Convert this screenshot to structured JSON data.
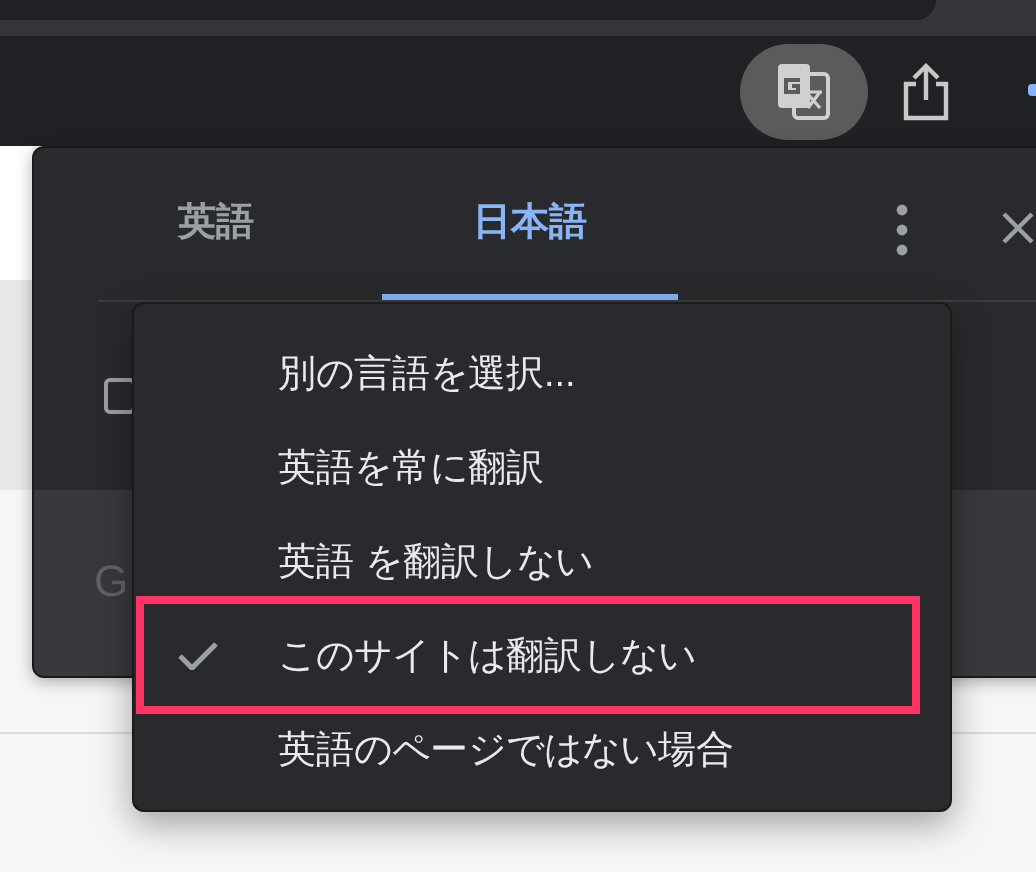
{
  "tabs": [
    {
      "label": "英語",
      "selected": false
    },
    {
      "label": "日本語",
      "selected": true
    }
  ],
  "checkbox": {
    "checked": false
  },
  "footer_text": "G",
  "menu": [
    {
      "label": "別の言語を選択...",
      "checked": false,
      "highlighted": false
    },
    {
      "label": "英語を常に翻訳",
      "checked": false,
      "highlighted": false
    },
    {
      "label": "英語 を翻訳しない",
      "checked": false,
      "highlighted": false
    },
    {
      "label": "このサイトは翻訳しない",
      "checked": true,
      "highlighted": true
    },
    {
      "label": "英語のページではない場合",
      "checked": false,
      "highlighted": false
    }
  ]
}
